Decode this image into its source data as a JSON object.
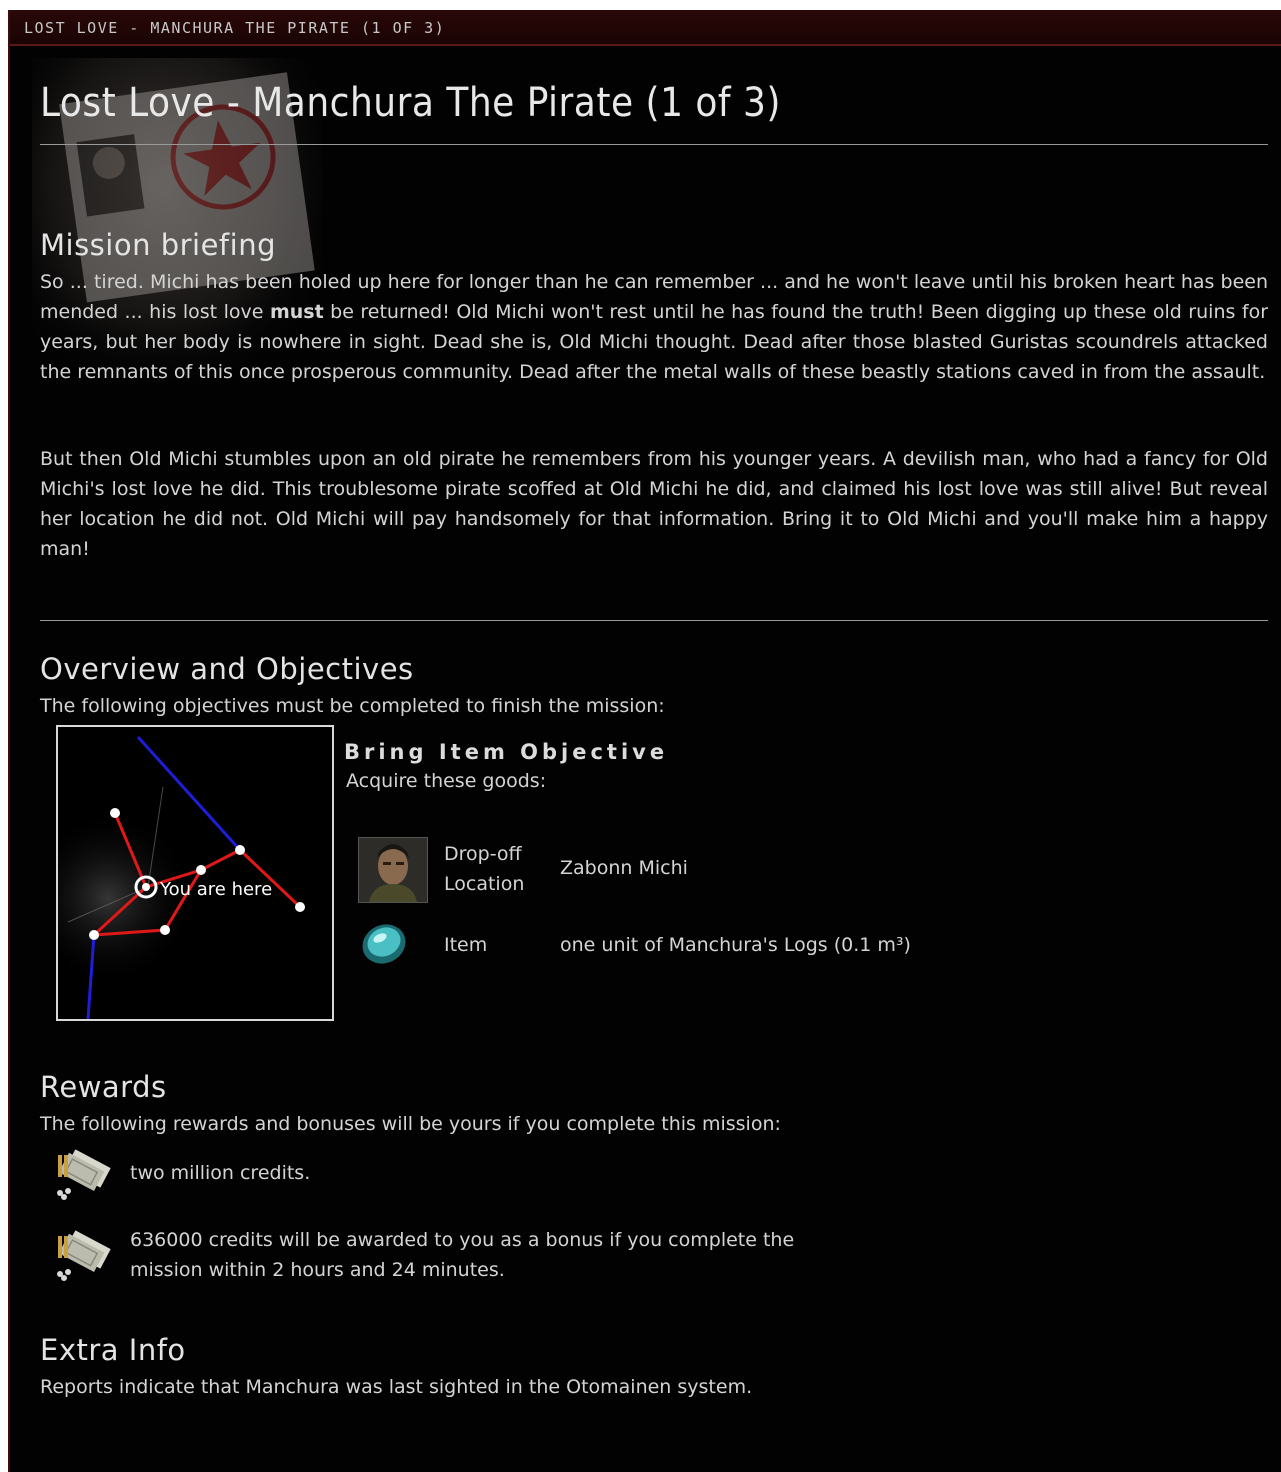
{
  "window": {
    "title": "LOST LOVE - MANCHURA THE PIRATE (1 OF 3)"
  },
  "header": {
    "title": "Lost Love - Manchura The Pirate (1 of 3)"
  },
  "briefing": {
    "heading": "Mission briefing",
    "p1_a": "So ... tired. Michi has been holed up here for longer than he can remember ... and he won't leave until his broken heart has been mended ... his lost love ",
    "p1_bold": "must",
    "p1_b": " be returned! Old Michi won't rest until he has found the truth! Been digging up these old ruins for years, but her body is nowhere in sight. Dead she is, Old Michi thought. Dead after those blasted Guristas scoundrels attacked the remnants of this once prosperous community. Dead after the metal walls of these beastly stations caved in from the assault.",
    "p2": "But then Old Michi stumbles upon an old pirate he remembers from his younger years. A devilish man, who had a fancy for Old Michi's lost love he did. This troublesome pirate scoffed at Old Michi he did, and claimed his lost love was still alive! But reveal her location he did not. Old Michi will pay handsomely for that information. Bring it to Old Michi and you'll make him a happy man!"
  },
  "overview": {
    "heading": "Overview and Objectives",
    "subtitle": "The following objectives must be completed to finish the mission:",
    "map_label": "You are here",
    "objective_title": "Bring Item Objective",
    "objective_sub": "Acquire these goods:",
    "dropoff_label_1": "Drop-off",
    "dropoff_label_2": "Location",
    "dropoff_value": "Zabonn Michi",
    "item_label": "Item",
    "item_value": "one unit of Manchura's Logs (0.1 m³)"
  },
  "rewards": {
    "heading": "Rewards",
    "subtitle": "The following rewards and bonuses will be yours if you complete this mission:",
    "reward1": "two million credits.",
    "bonus_line1": "636000 credits will be awarded to you as a bonus if you complete the",
    "bonus_line2": "mission within 2 hours and 24 minutes."
  },
  "extra": {
    "heading": "Extra Info",
    "text": "Reports indicate that Manchura was last sighted in the Otomainen system."
  },
  "icons": {
    "portrait": "character-portrait-icon",
    "item": "data-crystal-icon",
    "credits": "isk-credits-icon"
  },
  "colors": {
    "background": "#020202",
    "titlebar": "#2a0808",
    "text": "#d4d4d4",
    "route": "#e01818",
    "stargate_link": "#1818d0"
  }
}
